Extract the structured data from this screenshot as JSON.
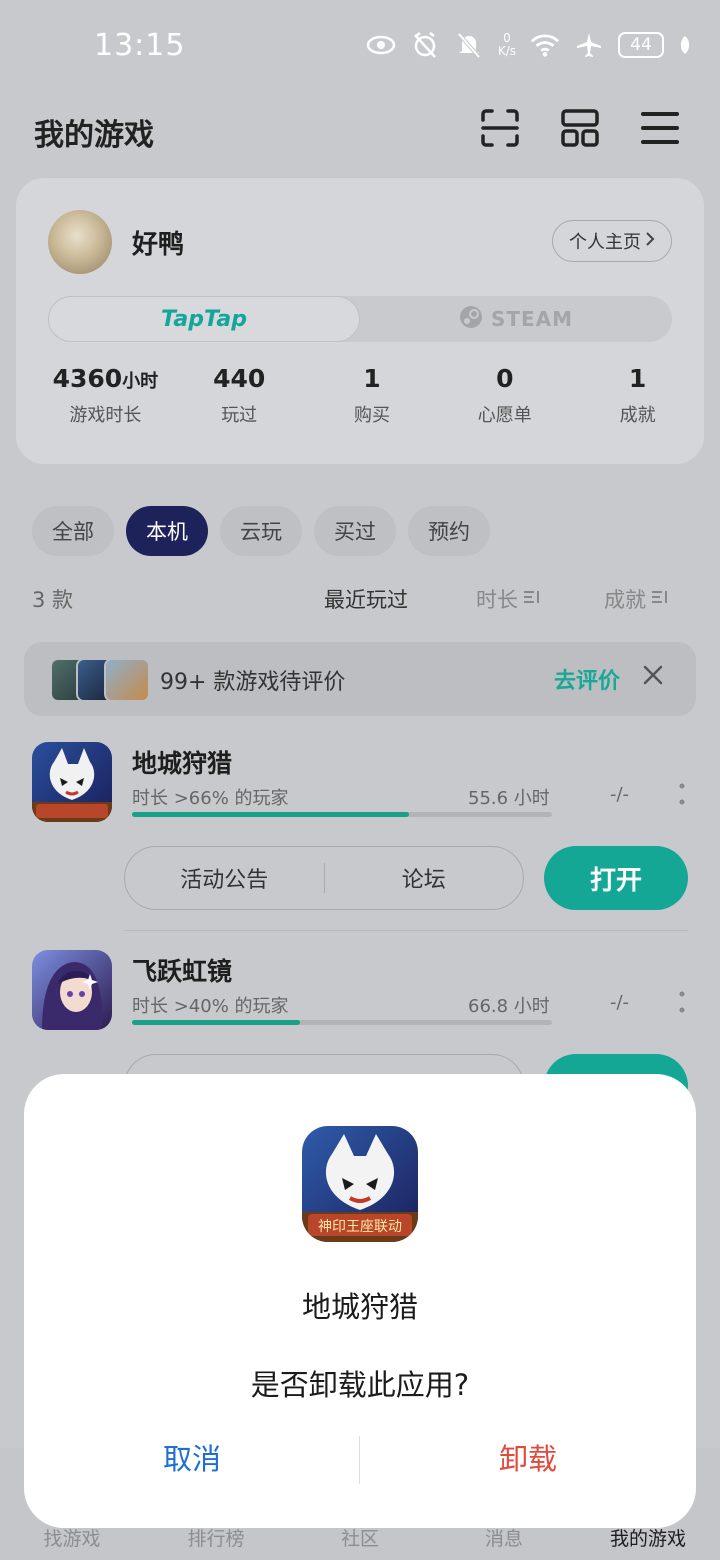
{
  "status_bar": {
    "time": "13:15",
    "net_speed_value": "0",
    "net_speed_unit": "K/s",
    "battery": "44"
  },
  "header": {
    "title": "我的游戏"
  },
  "profile": {
    "name": "好鸭",
    "home_label": "个人主页",
    "platforms": {
      "taptap": "TapTap",
      "steam": "STEAM"
    },
    "stats": [
      {
        "value": "4360",
        "unit": "小时",
        "label": "游戏时长"
      },
      {
        "value": "440",
        "unit": "",
        "label": "玩过"
      },
      {
        "value": "1",
        "unit": "",
        "label": "购买"
      },
      {
        "value": "0",
        "unit": "",
        "label": "心愿单"
      },
      {
        "value": "1",
        "unit": "",
        "label": "成就"
      }
    ]
  },
  "filters": [
    "全部",
    "本机",
    "云玩",
    "买过",
    "预约"
  ],
  "active_filter": "本机",
  "sort": {
    "count": "3 款",
    "recent": "最近玩过",
    "duration": "时长",
    "achievement": "成就"
  },
  "review_banner": {
    "text": "99+ 款游戏待评价",
    "action": "去评价"
  },
  "games": [
    {
      "name": "地城狩猎",
      "rank": "时长 >66% 的玩家",
      "hours": "55.6 小时",
      "achievement": "-/-",
      "progress": 0.66,
      "actions": [
        "活动公告",
        "论坛"
      ],
      "open": "打开"
    },
    {
      "name": "飞跃虹镜",
      "rank": "时长 >40% 的玩家",
      "hours": "66.8 小时",
      "achievement": "-/-",
      "progress": 0.4,
      "actions": [],
      "open": ""
    }
  ],
  "bottom_nav": [
    "找游戏",
    "排行榜",
    "社区",
    "消息",
    "我的游戏"
  ],
  "active_nav": "我的游戏",
  "dialog": {
    "game_name": "地城狩猎",
    "message": "是否卸载此应用?",
    "cancel": "取消",
    "confirm": "卸载",
    "icon_badge": "神印王座联动"
  },
  "colors": {
    "accent": "#15a796",
    "active_chip": "#1d235a",
    "cancel": "#1e6fd4",
    "danger": "#e14a3b"
  }
}
